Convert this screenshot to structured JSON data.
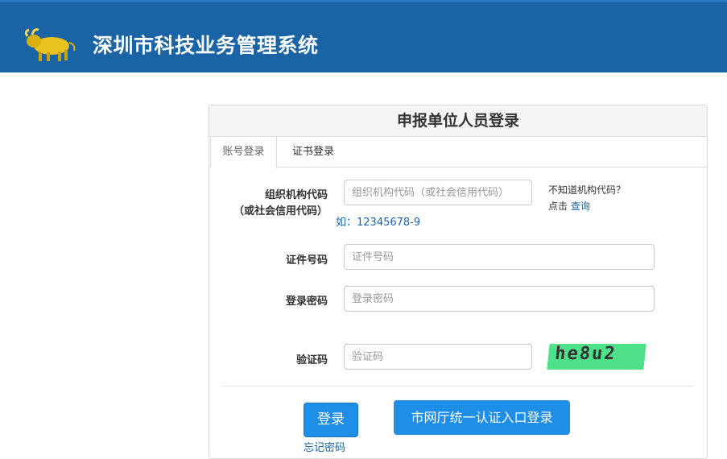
{
  "header": {
    "title": "深圳市科技业务管理系统",
    "logo_icon": "bull-logo-icon",
    "bg_color": "#1a64a6"
  },
  "panel": {
    "title": "申报单位人员登录",
    "tabs": [
      {
        "label": "账号登录",
        "active": true
      },
      {
        "label": "证书登录",
        "active": false
      }
    ]
  },
  "form": {
    "org_code": {
      "label_line1": "组织机构代码",
      "label_line2": "（或社会信用代码）",
      "placeholder": "组织机构代码（或社会信用代码）",
      "example": "如：12345678-9"
    },
    "side_note": {
      "question": "不知道机构代码？",
      "prefix": "点击",
      "link": "查询"
    },
    "cert_no": {
      "label": "证件号码",
      "placeholder": "证件号码"
    },
    "password": {
      "label": "登录密码",
      "placeholder": "登录密码"
    },
    "captcha": {
      "label": "验证码",
      "placeholder": "验证码",
      "image_text": "he8u2"
    }
  },
  "actions": {
    "login": "登录",
    "city_login": "市网厅统一认证入口登录",
    "forgot": "忘记密码"
  }
}
